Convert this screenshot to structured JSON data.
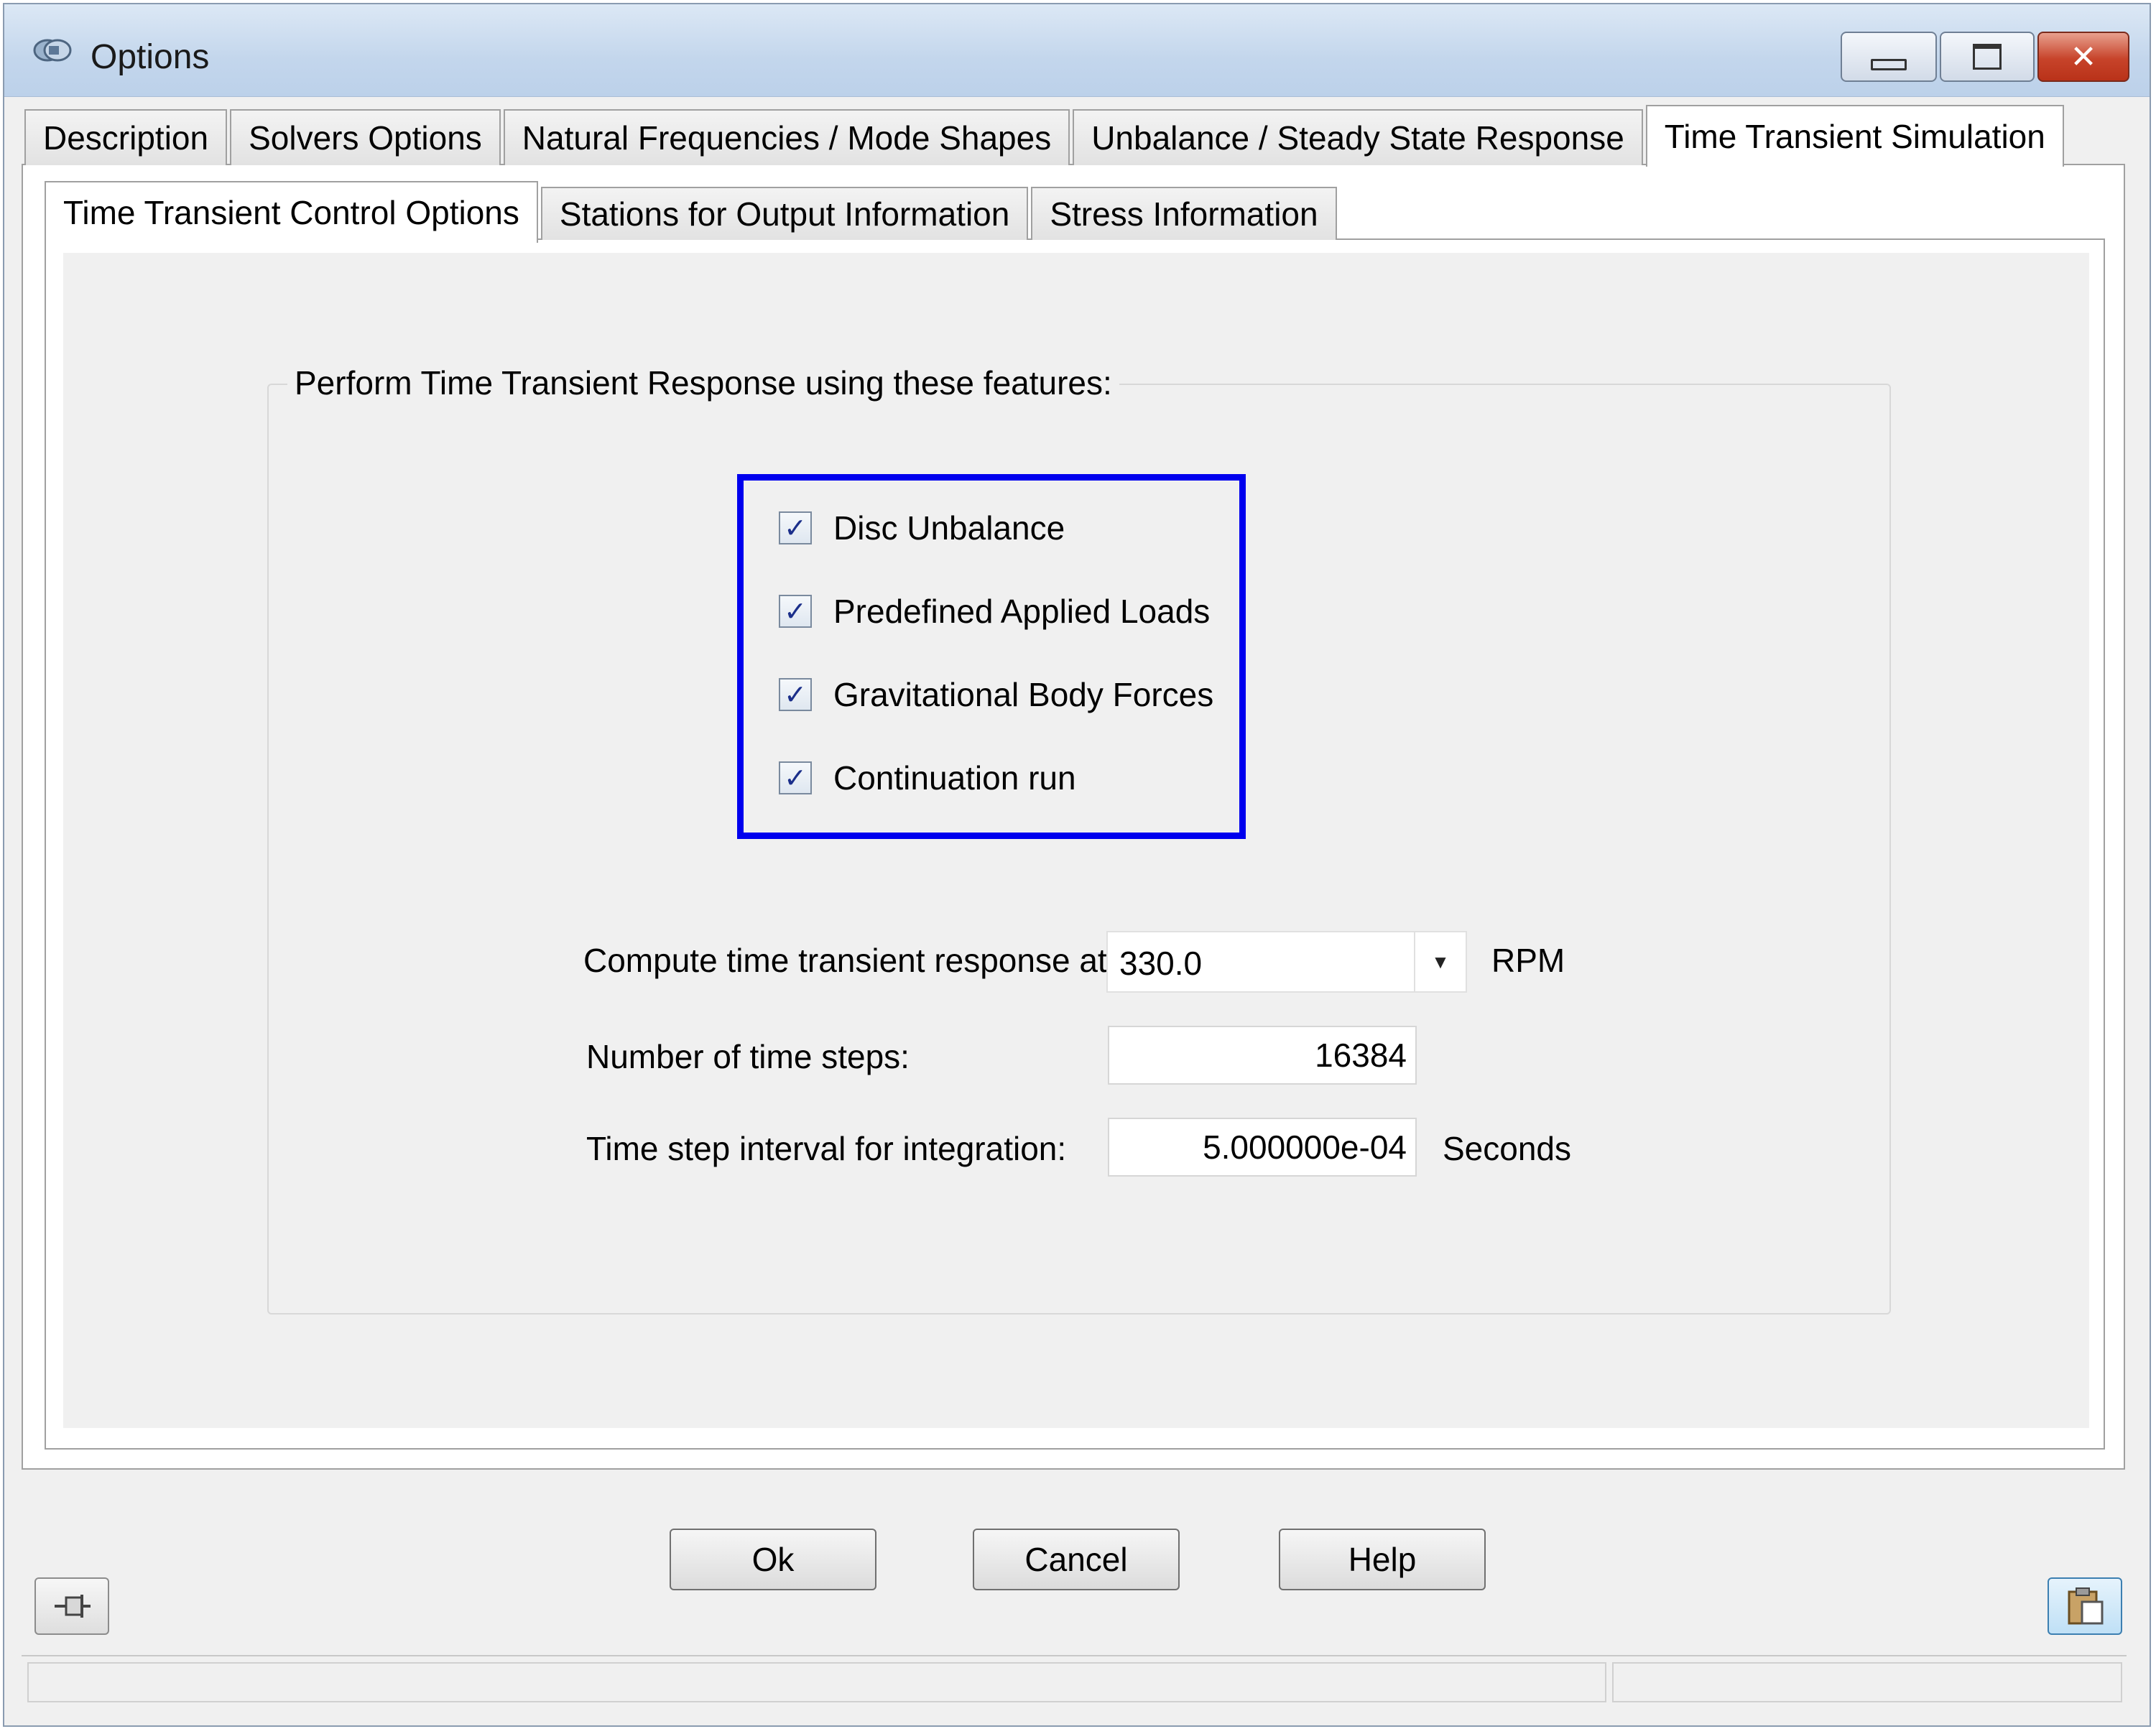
{
  "window": {
    "title": "Options",
    "icon": "app-options-icon"
  },
  "main_tabs": [
    {
      "label": "Description"
    },
    {
      "label": "Solvers Options"
    },
    {
      "label": "Natural Frequencies / Mode Shapes"
    },
    {
      "label": "Unbalance / Steady State Response"
    },
    {
      "label": "Time Transient Simulation",
      "active": true
    }
  ],
  "sub_tabs": [
    {
      "label": "Time Transient Control Options",
      "active": true
    },
    {
      "label": "Stations for Output Information"
    },
    {
      "label": "Stress Information"
    }
  ],
  "features": {
    "legend": "Perform Time Transient Response using these features:",
    "items": [
      {
        "label": "Disc Unbalance",
        "checked": true
      },
      {
        "label": "Predefined Applied Loads",
        "checked": true
      },
      {
        "label": "Gravitational Body Forces",
        "checked": true
      },
      {
        "label": "Continuation run",
        "checked": true
      }
    ],
    "highlight_color": "#0000ee"
  },
  "settings": {
    "speed_label": "Compute time transient response at",
    "speed_value": "330.0",
    "speed_unit": "RPM",
    "steps_label": "Number of time steps:",
    "steps_value": "16384",
    "interval_label": "Time step interval for integration:",
    "interval_value": "5.000000e-04",
    "interval_unit": "Seconds"
  },
  "buttons": {
    "ok": "Ok",
    "cancel": "Cancel",
    "help": "Help"
  },
  "icons": {
    "bottom_left": "pin-icon",
    "bottom_right": "clipboard-icon"
  }
}
